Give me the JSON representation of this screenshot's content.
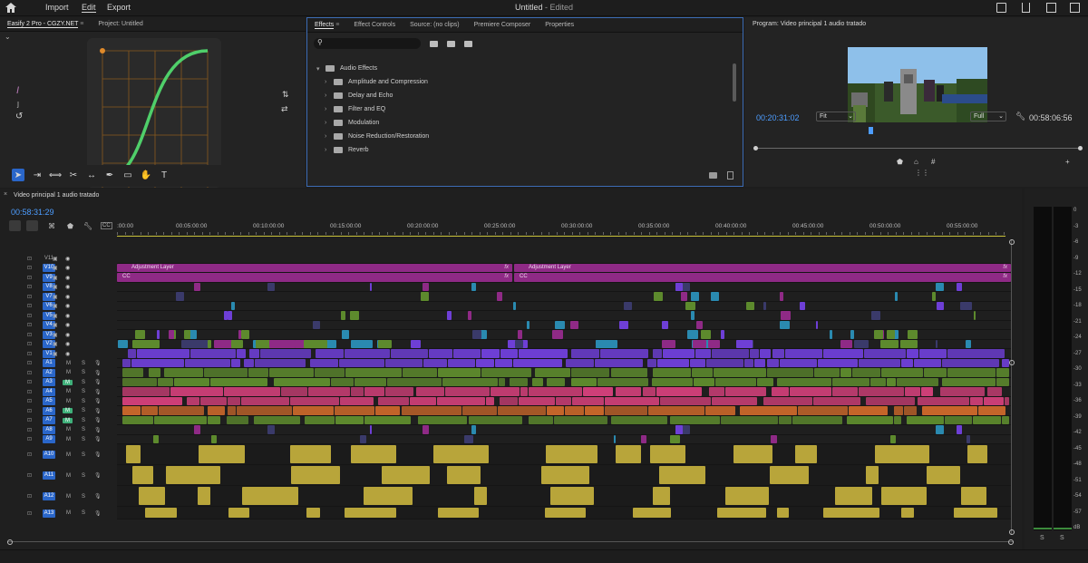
{
  "topbar": {
    "nav": [
      "Import",
      "Edit",
      "Export"
    ],
    "active_nav": "Edit",
    "doc_title": "Untitled",
    "doc_status": "- Edited"
  },
  "left_panel": {
    "tabs": [
      "Easify 2 Pro - CGZY.NET",
      "Project: Untitled"
    ]
  },
  "effects_panel": {
    "tabs": [
      "Effects",
      "Effect Controls",
      "Source: (no clips)",
      "Premiere Composer",
      "Properties"
    ],
    "search_placeholder": "",
    "group": "Audio Effects",
    "items": [
      "Amplitude and Compression",
      "Delay and Echo",
      "Filter and EQ",
      "Modulation",
      "Noise Reduction/Restoration",
      "Reverb"
    ]
  },
  "program": {
    "title": "Program: Video principal 1 audio tratado",
    "timecode": "00:20:31:02",
    "fit": "Fit",
    "quality": "Full",
    "duration": "00:58:06:56",
    "playhead_fraction": 0.355
  },
  "timeline": {
    "sequence_name": "Video principal 1 audio tratado",
    "timecode": "00:58:31:29",
    "ruler": [
      ":00:00",
      "00:05:00:00",
      "00:10:00:00",
      "00:15:00:00",
      "00:20:00:00",
      "00:25:00:00",
      "00:30:00:00",
      "00:35:00:00",
      "00:40:00:00",
      "00:45:00:00",
      "00:50:00:00",
      "00:55:00:00"
    ],
    "video_tracks": [
      "V11",
      "V10",
      "V9",
      "V8",
      "V7",
      "V6",
      "V5",
      "V4",
      "V3",
      "V2",
      "V1"
    ],
    "audio_tracks": [
      "A1",
      "A2",
      "A3",
      "A4",
      "A5",
      "A6",
      "A7",
      "A8",
      "A9"
    ],
    "large_audio_tracks": [
      "A10",
      "A11",
      "A12",
      "A13"
    ],
    "adjustment_label": "Adjustment Layer",
    "cc_label": "CC",
    "fx_label": "fx",
    "mute": "M",
    "solo": "S"
  },
  "meters": {
    "scale": [
      "0",
      "-3",
      "-6",
      "-9",
      "-12",
      "-15",
      "-18",
      "-21",
      "-24",
      "-27",
      "-30",
      "-33",
      "-36",
      "-39",
      "-42",
      "-45",
      "-48",
      "-51",
      "-54",
      "-57",
      "dB"
    ],
    "solo_labels": [
      "S",
      "S"
    ]
  },
  "colors": {
    "accent": "#2a66c9",
    "adjustment": "#8f2a86",
    "video_v1": "#6e3fd6",
    "audio_green": "#5d8a2d",
    "audio_pink": "#cf3f78",
    "audio_orange": "#c9672a",
    "music_gold": "#b8a53a"
  }
}
